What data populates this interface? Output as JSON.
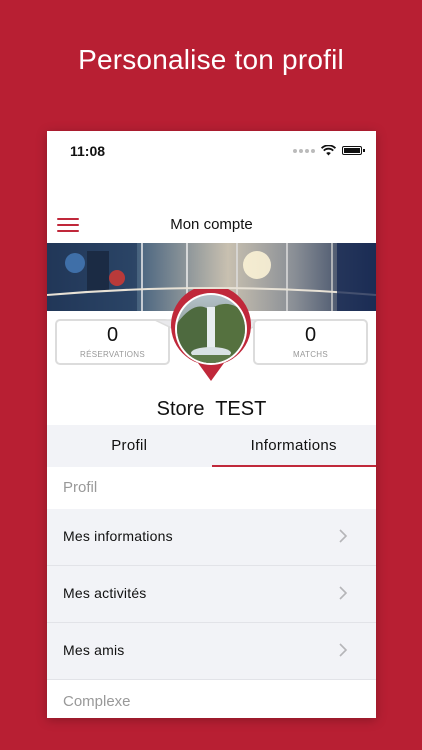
{
  "headline": "Personalise ton profil",
  "status_bar": {
    "time": "11:08"
  },
  "navbar": {
    "title": "Mon compte"
  },
  "stats": {
    "reservations": {
      "value": "0",
      "label": "RÉSERVATIONS"
    },
    "matchs": {
      "value": "0",
      "label": "MATCHS"
    }
  },
  "profile": {
    "name": "Store  TEST"
  },
  "tabs": [
    {
      "label": "Profil",
      "active": false
    },
    {
      "label": "Informations",
      "active": true
    }
  ],
  "sections": [
    {
      "title": "Profil",
      "items": [
        {
          "label": "Mes informations"
        },
        {
          "label": "Mes activités"
        },
        {
          "label": "Mes amis"
        }
      ]
    },
    {
      "title": "Complexe",
      "items": []
    }
  ],
  "colors": {
    "brand": "#b81f33",
    "accent": "#c0283a",
    "list_bg": "#f2f3f7"
  }
}
